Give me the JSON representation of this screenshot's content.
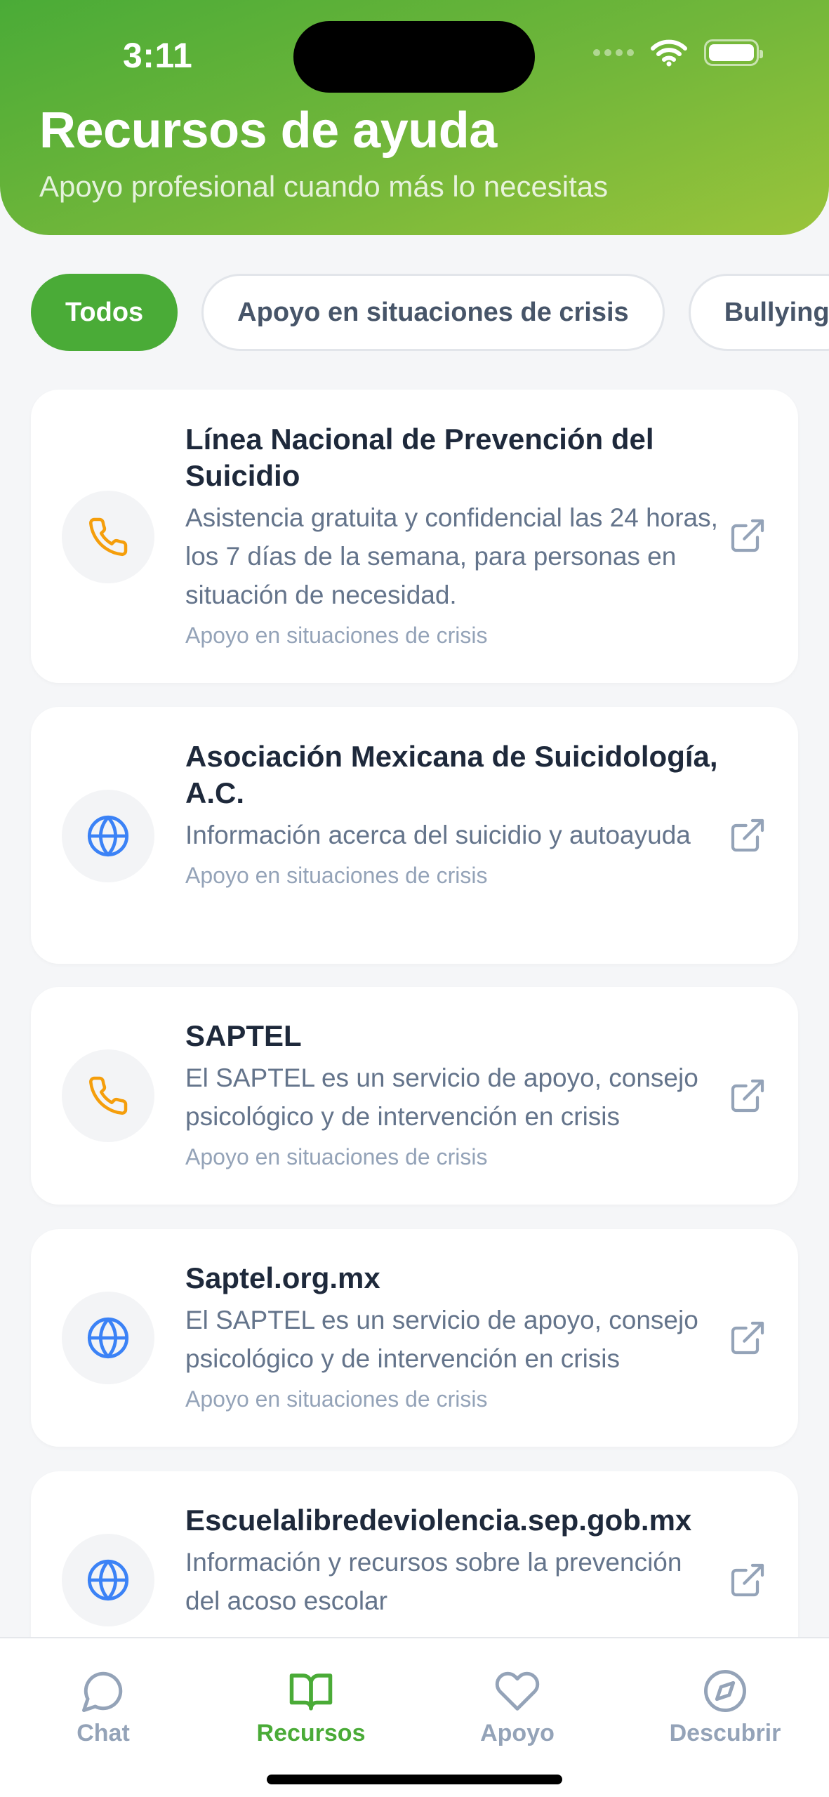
{
  "status": {
    "time": "3:11"
  },
  "header": {
    "title": "Recursos de ayuda",
    "subtitle": "Apoyo profesional cuando más lo necesitas"
  },
  "filters": [
    {
      "label": "Todos",
      "active": true
    },
    {
      "label": "Apoyo en situaciones de crisis",
      "active": false
    },
    {
      "label": "Bullying",
      "active": false
    }
  ],
  "resources": [
    {
      "title": "Línea Nacional de Prevención del Suicidio",
      "description": "Asistencia gratuita y confidencial las 24 horas, los 7 días de la semana, para personas en situación de necesidad.",
      "category": "Apoyo en situaciones de crisis",
      "icon": "phone-icon"
    },
    {
      "title": "Asociación Mexicana de Suicidología, A.C.",
      "description": "Información acerca del suicidio y autoayuda",
      "category": "Apoyo en situaciones de crisis",
      "icon": "globe-icon"
    },
    {
      "title": "SAPTEL",
      "description": "El SAPTEL es un servicio de apoyo, consejo psicológico y de intervención en crisis",
      "category": "Apoyo en situaciones de crisis",
      "icon": "phone-icon"
    },
    {
      "title": "Saptel.org.mx",
      "description": "El SAPTEL es un servicio de apoyo, consejo psicológico y de intervención en crisis",
      "category": "Apoyo en situaciones de crisis",
      "icon": "globe-icon"
    },
    {
      "title": "Escuelalibredeviolencia.sep.gob.mx",
      "description": "Información y recursos sobre la prevención del acoso escolar",
      "category": "",
      "icon": "globe-icon"
    }
  ],
  "tabs": [
    {
      "label": "Chat",
      "icon": "chat-bubble-icon",
      "active": false
    },
    {
      "label": "Recursos",
      "icon": "book-icon",
      "active": true
    },
    {
      "label": "Apoyo",
      "icon": "heart-icon",
      "active": false
    },
    {
      "label": "Descubrir",
      "icon": "compass-icon",
      "active": false
    }
  ],
  "colors": {
    "brand": "#4aab37",
    "phone_icon": "#f59e0b",
    "globe_icon": "#3b82f6",
    "muted": "#94a3b8"
  }
}
